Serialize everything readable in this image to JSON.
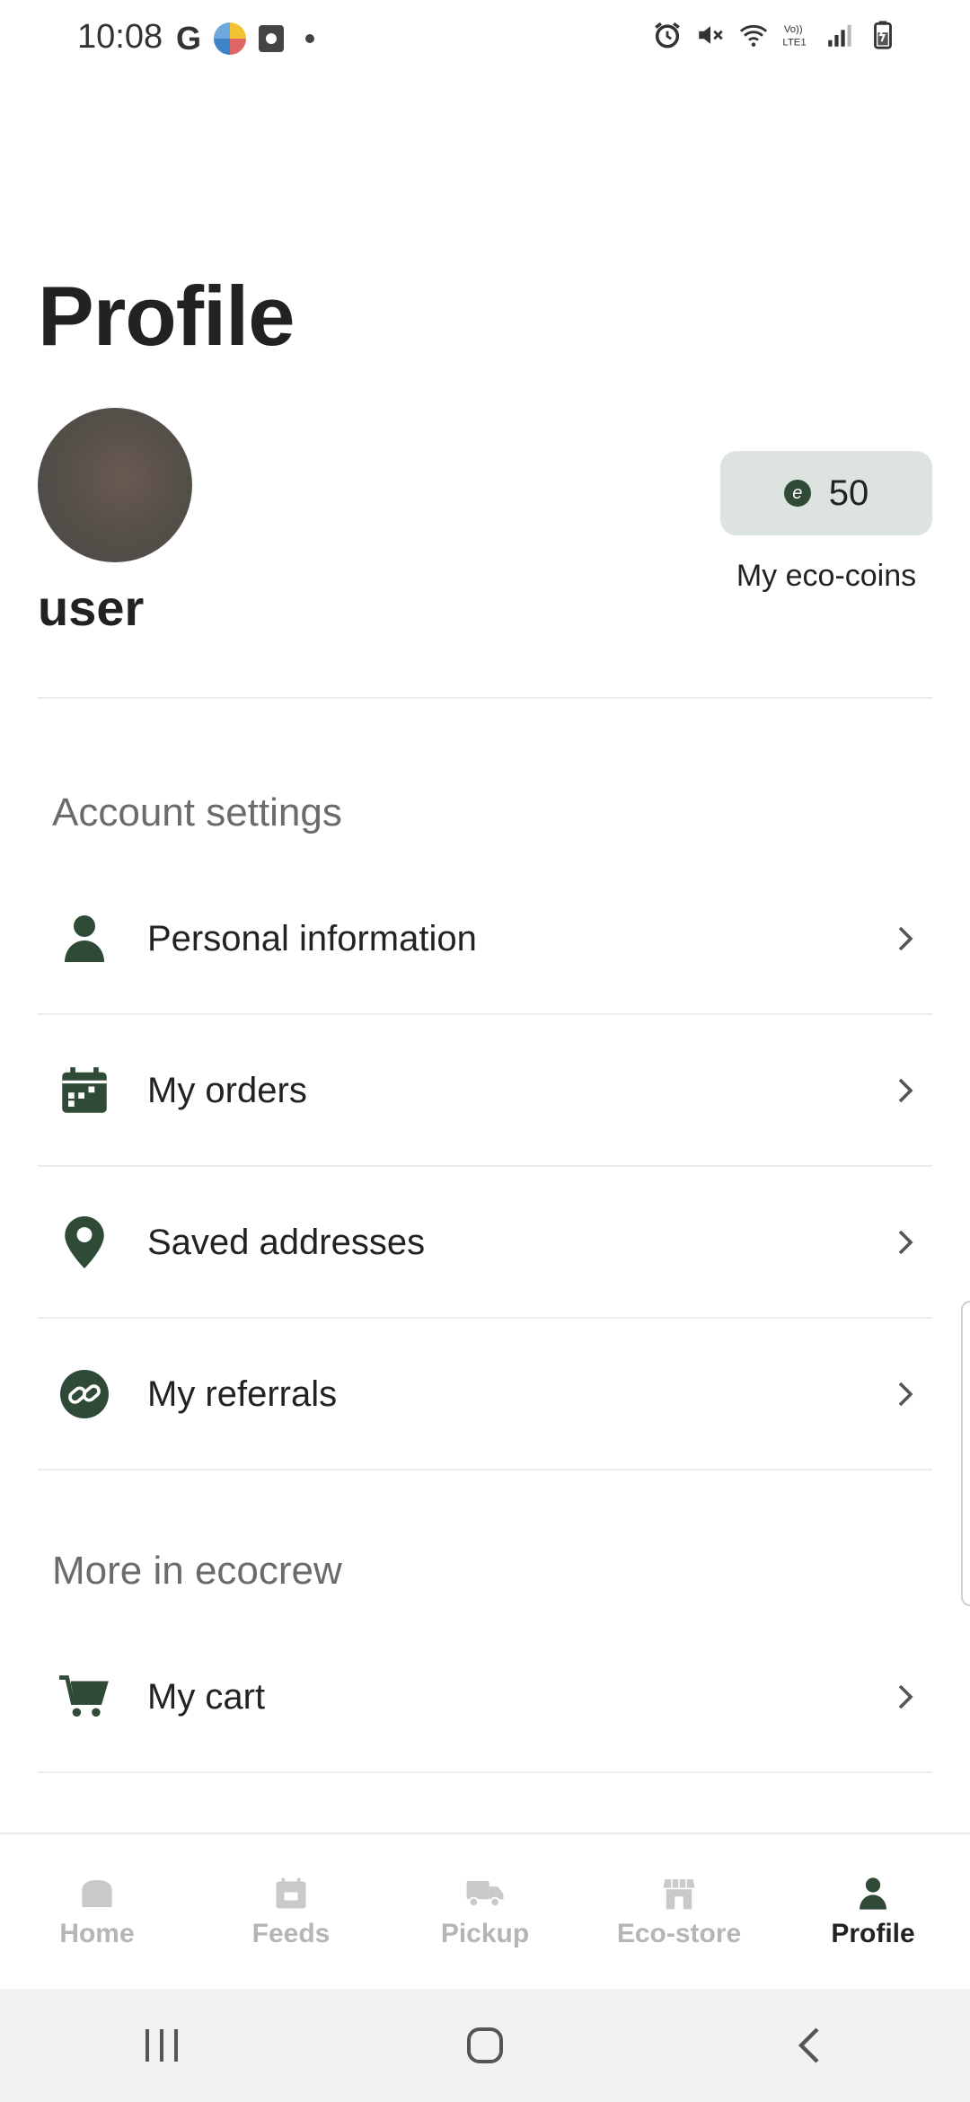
{
  "status_bar": {
    "time": "10:08",
    "left_icons": [
      "google-icon",
      "app-icon",
      "clock-app-icon",
      "dot-icon"
    ],
    "right_icons": [
      "alarm-icon",
      "mute-icon",
      "wifi-icon",
      "volte-icon",
      "signal-icon",
      "battery-icon"
    ],
    "volte_text": "Vo)) LTE1"
  },
  "header": {
    "title": "Profile"
  },
  "user": {
    "name": "user",
    "eco_coins": "50",
    "eco_coins_label": "My eco-coins"
  },
  "sections": {
    "account_title": "Account settings",
    "account_items": [
      {
        "label": "Personal information",
        "icon": "person-icon"
      },
      {
        "label": "My orders",
        "icon": "calendar-icon"
      },
      {
        "label": "Saved addresses",
        "icon": "location-pin-icon"
      },
      {
        "label": "My referrals",
        "icon": "link-icon"
      }
    ],
    "more_title": "More in ecocrew",
    "more_items": [
      {
        "label": "My cart",
        "icon": "cart-icon"
      }
    ]
  },
  "bottom_nav": {
    "items": [
      {
        "label": "Home",
        "icon": "home-icon",
        "active": false
      },
      {
        "label": "Feeds",
        "icon": "feeds-icon",
        "active": false
      },
      {
        "label": "Pickup",
        "icon": "truck-icon",
        "active": false
      },
      {
        "label": "Eco-store",
        "icon": "store-icon",
        "active": false
      },
      {
        "label": "Profile",
        "icon": "person-icon",
        "active": true
      }
    ]
  },
  "colors": {
    "accent": "#2f4a36",
    "badge_bg": "#dde3df",
    "inactive_nav": "#b5b5b5"
  }
}
